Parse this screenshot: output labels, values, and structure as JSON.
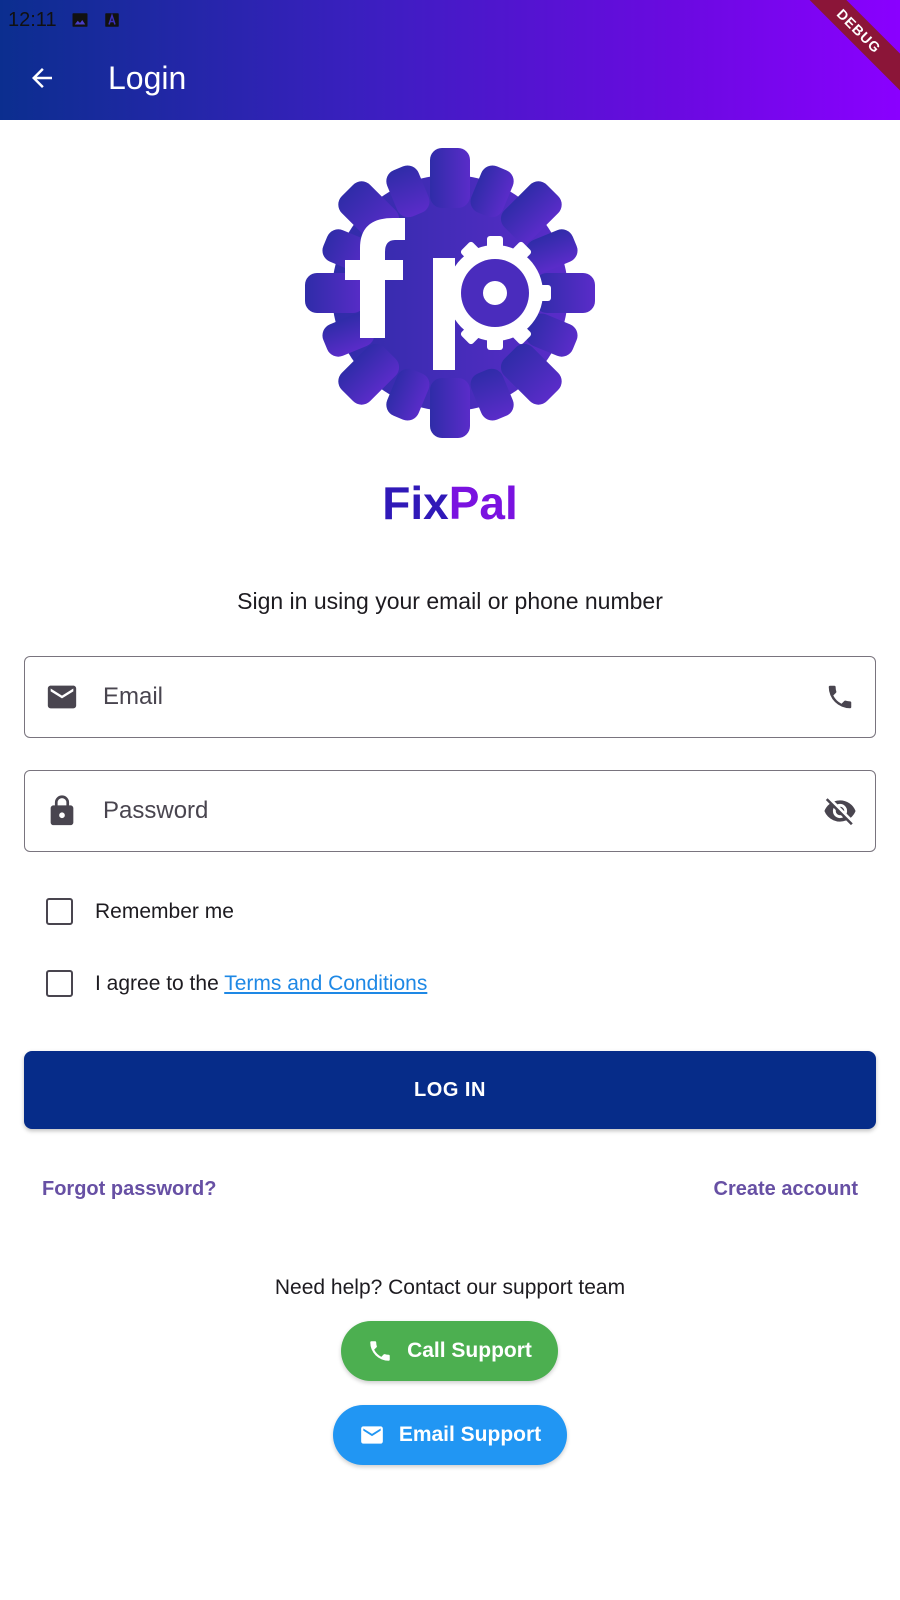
{
  "status_bar": {
    "time": "12:11"
  },
  "app_bar": {
    "title": "Login",
    "debug_label": "DEBUG"
  },
  "brand": {
    "name_part1": "Fix",
    "name_part2": "Pal"
  },
  "form": {
    "subtitle": "Sign in using your email or phone number",
    "email_placeholder": "Email",
    "password_placeholder": "Password",
    "remember_label": "Remember me",
    "agree_prefix": "I agree to the ",
    "terms_link": "Terms and Conditions",
    "login_label": "LOG IN",
    "forgot_password": "Forgot password?",
    "create_account": "Create account"
  },
  "support": {
    "help_text": "Need help? Contact our support team",
    "call_label": "Call Support",
    "email_label": "Email Support"
  },
  "colors": {
    "login_button": "#062c89",
    "call_button": "#4caf50",
    "email_button": "#2196f3",
    "link": "#6750a4",
    "terms_link": "#1e88e5"
  }
}
